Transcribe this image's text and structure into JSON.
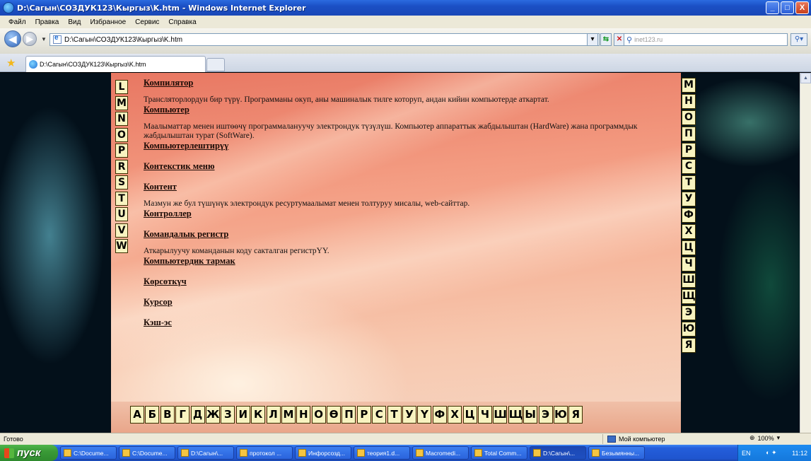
{
  "window": {
    "title": "D:\\Сагын\\СОЗДУК123\\Кыргыз\\K.htm - Windows Internet Explorer",
    "minimize": "_",
    "maximize": "□",
    "close": "X"
  },
  "menu": [
    "Файл",
    "Правка",
    "Вид",
    "Избранное",
    "Сервис",
    "Справка"
  ],
  "address": {
    "url": "D:\\Сагын\\СОЗДУК123\\Кыргыз\\K.htm",
    "search_placeholder": "inet123.ru"
  },
  "tab": {
    "label": "D:\\Сагын\\СОЗДУК123\\Кыргыз\\K.htm"
  },
  "left_letters": [
    "L",
    "M",
    "N",
    "O",
    "P",
    "R",
    "S",
    "T",
    "U",
    "V",
    "W"
  ],
  "right_letters": [
    "М",
    "Н",
    "О",
    "П",
    "Р",
    "С",
    "Т",
    "У",
    "Ф",
    "Х",
    "Ц",
    "Ч",
    "Ш",
    "Щ",
    "Э",
    "Ю",
    "Я"
  ],
  "bottom_letters": [
    "А",
    "Б",
    "В",
    "Г",
    "Д",
    "Ж",
    "З",
    "И",
    "К",
    "Л",
    "М",
    "Н",
    "О",
    "Ө",
    "П",
    "Р",
    "С",
    "Т",
    "У",
    "Ү",
    "Ф",
    "Х",
    "Ц",
    "Ч",
    "Ш",
    "Щ",
    "Ы",
    "Э",
    "Ю",
    "Я"
  ],
  "entries": [
    {
      "term": "Компилятор",
      "definition": "Трансляторлордун бир түрү. Программаны окуп, аны машиналык тилге которуп, андан кийин компьютерде аткартат."
    },
    {
      "term": "Компьютер",
      "definition": "Маалыматтар менен иштөөчү программалануучу электрондук түзүлүш. Компьютер аппараттык жабдылыштан (HardWare) жана программдык жабдылыштан турат (SoftWare)."
    },
    {
      "term": "Компьютерлештирүү",
      "definition": ""
    },
    {
      "term": "Контекстик меню",
      "definition": ""
    },
    {
      "term": "Контент",
      "definition": "Мазмун же бул түшүнүк электрондук ресуртумаалымат менен толтуруу мисалы, web-сайттар."
    },
    {
      "term": "Контроллер",
      "definition": ""
    },
    {
      "term": "Командалык регистр",
      "definition": "Аткарылуучу команданын коду сакталган регистрYY."
    },
    {
      "term": "Компьютердик тармак",
      "definition": ""
    },
    {
      "term": "Көрсөткүч",
      "definition": ""
    },
    {
      "term": "Курсор",
      "definition": ""
    },
    {
      "term": "Кэш-эс",
      "definition": ""
    }
  ],
  "status": {
    "text": "Готово",
    "zone": "Мой компьютер",
    "zoom": "100%"
  },
  "taskbar": {
    "start": "пуск",
    "tasks": [
      "C:\\Docume...",
      "C:\\Docume...",
      "D:\\Сагын\\...",
      "протокол ...",
      "Инфорсозд...",
      "теория1.d...",
      "Macromedi...",
      "Total Comm...",
      "D:\\Сагын\\...",
      "Безымянны..."
    ],
    "active_index": 8,
    "lang": "EN",
    "clock": "11:12"
  }
}
